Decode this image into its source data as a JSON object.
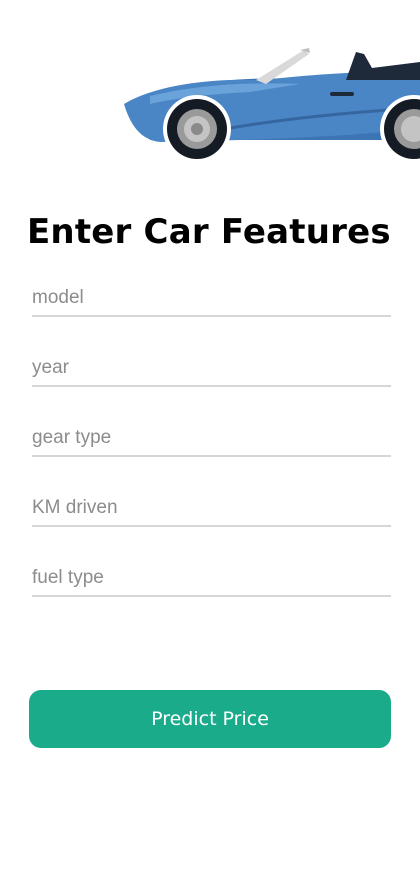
{
  "header": {
    "illustration_icon": "convertible-car-icon",
    "title": "Enter Car Features"
  },
  "form": {
    "fields": [
      {
        "placeholder": "model",
        "value": ""
      },
      {
        "placeholder": "year",
        "value": ""
      },
      {
        "placeholder": "gear type",
        "value": ""
      },
      {
        "placeholder": "KM driven",
        "value": ""
      },
      {
        "placeholder": "fuel type",
        "value": ""
      }
    ],
    "submit_label": "Predict Price"
  },
  "colors": {
    "accent": "#1aab8a",
    "car_body": "#4a86c5",
    "underline": "#d6d6d6",
    "placeholder": "#8c8c8c"
  }
}
